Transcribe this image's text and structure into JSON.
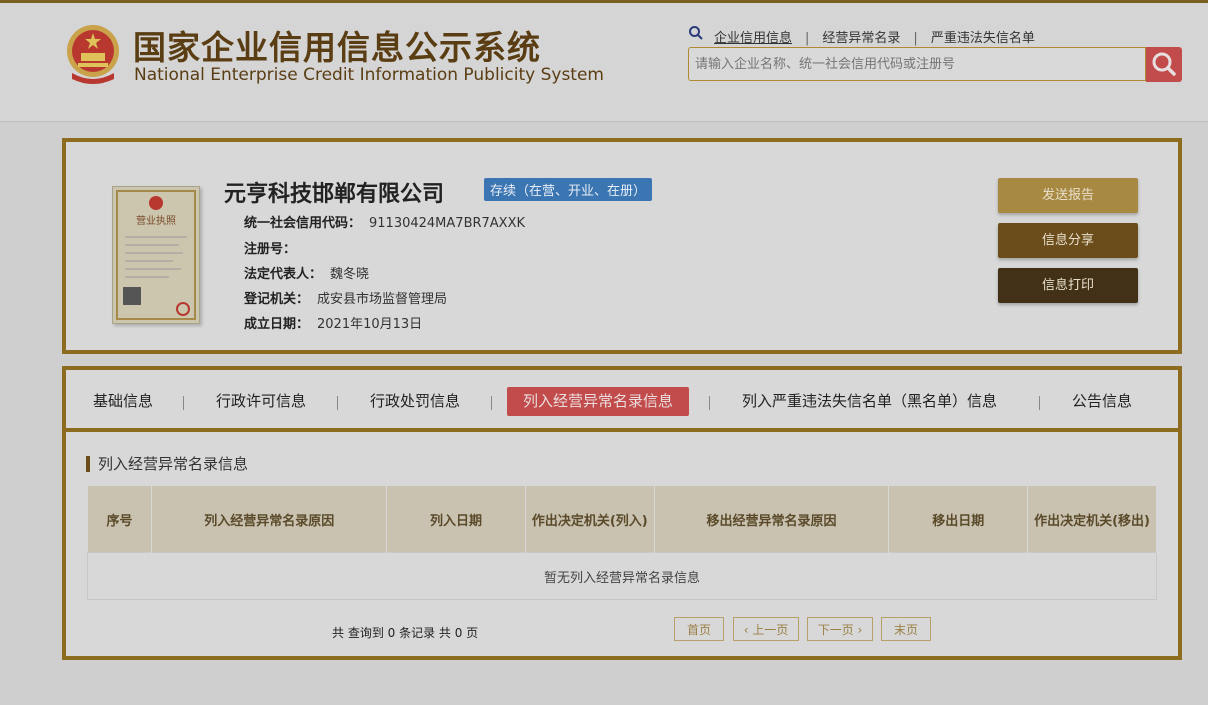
{
  "header": {
    "title_cn": "国家企业信用信息公示系统",
    "title_en": "National Enterprise Credit Information Publicity System",
    "links": [
      "企业信用信息",
      "经营异常名录",
      "严重违法失信名单"
    ],
    "search_placeholder": "请输入企业名称、统一社会信用代码或注册号",
    "search_icon": "search-icon"
  },
  "company": {
    "name": "元亨科技邯郸有限公司",
    "status": "存续（在营、开业、在册）",
    "fields": [
      {
        "label": "统一社会信用代码：",
        "value": "91130424MA7BR7AXXK"
      },
      {
        "label": "注册号：",
        "value": ""
      },
      {
        "label": "法定代表人：",
        "value": "魏冬晓"
      },
      {
        "label": "登记机关：",
        "value": "成安县市场监督管理局"
      },
      {
        "label": "成立日期：",
        "value": "2021年10月13日"
      }
    ],
    "license_caption": "营业执照",
    "buttons": {
      "send": "发送报告",
      "share": "信息分享",
      "print": "信息打印"
    }
  },
  "tabs": [
    "基础信息",
    "行政许可信息",
    "行政处罚信息",
    "列入经营异常名录信息",
    "列入严重违法失信名单（黑名单）信息",
    "公告信息"
  ],
  "active_tab": 3,
  "section": {
    "title": "列入经营异常名录信息",
    "columns": [
      "序号",
      "列入经营异常名录原因",
      "列入日期",
      "作出决定机关(列入)",
      "移出经营异常名录原因",
      "移出日期",
      "作出决定机关(移出)"
    ],
    "empty_text": "暂无列入经营异常名录信息"
  },
  "pagination": {
    "summary": "共 查询到 0 条记录 共 0 页",
    "first": "首页",
    "prev": "‹ 上一页",
    "next": "下一页 ›",
    "last": "末页"
  },
  "colors": {
    "accent_gold": "#8e6c1f",
    "active_red": "#c24b4b",
    "badge_blue": "#3b76b3"
  }
}
